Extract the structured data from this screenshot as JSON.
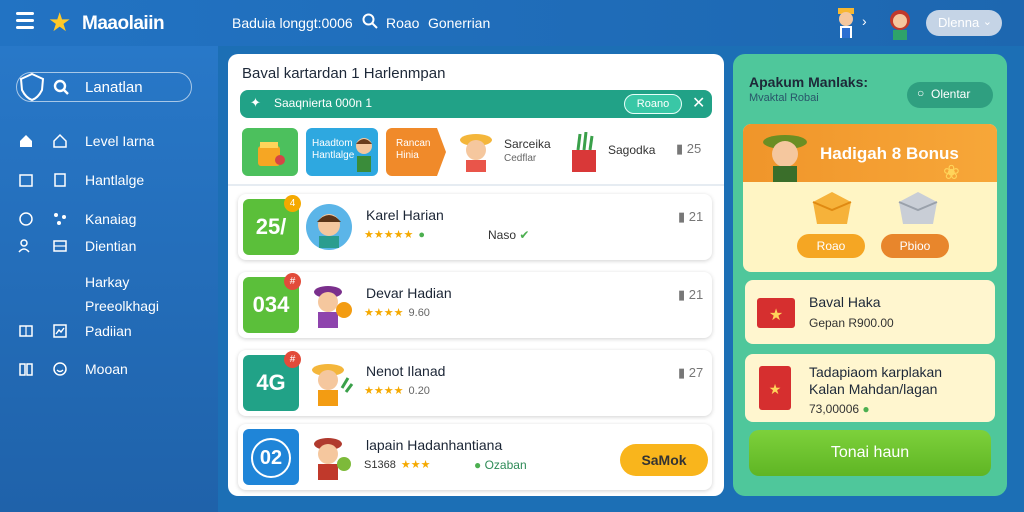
{
  "app": {
    "name": "Maaolaiin"
  },
  "topbar": {
    "link1": "Baduia longgt:0006",
    "search_label": "Roao",
    "link2": "Gonerrian",
    "user_label": "Dlenna"
  },
  "sidebar": {
    "search_label": "Lanatlan",
    "items": [
      {
        "label": "Level Iarna"
      },
      {
        "label": "Hantlalge"
      },
      {
        "label": "Kanaiag"
      },
      {
        "label": "Dientian"
      },
      {
        "label": "Harkay"
      },
      {
        "label": "Preeolkhagi"
      },
      {
        "label": "Padiian"
      },
      {
        "label": "Mooan"
      }
    ]
  },
  "main": {
    "title": "Baval kartardan 1 Harlenmpan",
    "banner_text": "Saaqnierta 000n 1",
    "banner_button": "Roano",
    "categories": {
      "tile2": "Haadtom\nHantlalge",
      "tile3": "Rancan\nHinia",
      "name1": "Sarceika",
      "sub1": "Cedflar",
      "name2": "Sagodka",
      "count": "25"
    },
    "cards": [
      {
        "badge": "25/",
        "dot": "4",
        "name": "Karel Harian",
        "stars": "★★★★★",
        "rating": "",
        "extra": "Naso",
        "count": "21",
        "badge_color": "#5bbf3a",
        "dot_color": "#f5a900"
      },
      {
        "badge": "034",
        "dot": "#",
        "name": "Devar Hadian",
        "stars": "★★★★",
        "rating": "9.60",
        "extra": "",
        "count": "21",
        "badge_color": "#5bbf3a",
        "dot_color": "#e24b3a"
      },
      {
        "badge": "4G",
        "dot": "#",
        "name": "Nenot Ilanad",
        "stars": "★★★★",
        "rating": "0.20",
        "extra": "",
        "count": "27",
        "badge_color": "#21a287",
        "dot_color": "#e24b3a"
      },
      {
        "badge": "02",
        "dot": "",
        "name": "lapain Hadanhantiana",
        "stars": "★★★",
        "rating": "S1368",
        "extra": "Ozaban",
        "count": "",
        "badge_color": "#1f85d8",
        "action": "SaMok"
      }
    ]
  },
  "panel": {
    "title": "Apakum Manlaks:",
    "subtitle": "Mvaktal Robai",
    "pill": "Olentar",
    "bonus_title": "Hadigah 8 Bonus",
    "bonus_btn1": "Roao",
    "bonus_btn2": "Pbioo",
    "card1_title": "Baval Haka",
    "card1_sub": "Gepan  R900.00",
    "card2_title": "Tadapiaom karplakan\nKalan Mahdan/lagan",
    "card2_sub": "73,00006",
    "cta": "Tonai haun"
  },
  "colors": {
    "topbar": "#2273c3",
    "teal": "#21a287",
    "panel": "#4fc79b",
    "orange": "#f0952a",
    "yellow": "#f9b51c"
  }
}
